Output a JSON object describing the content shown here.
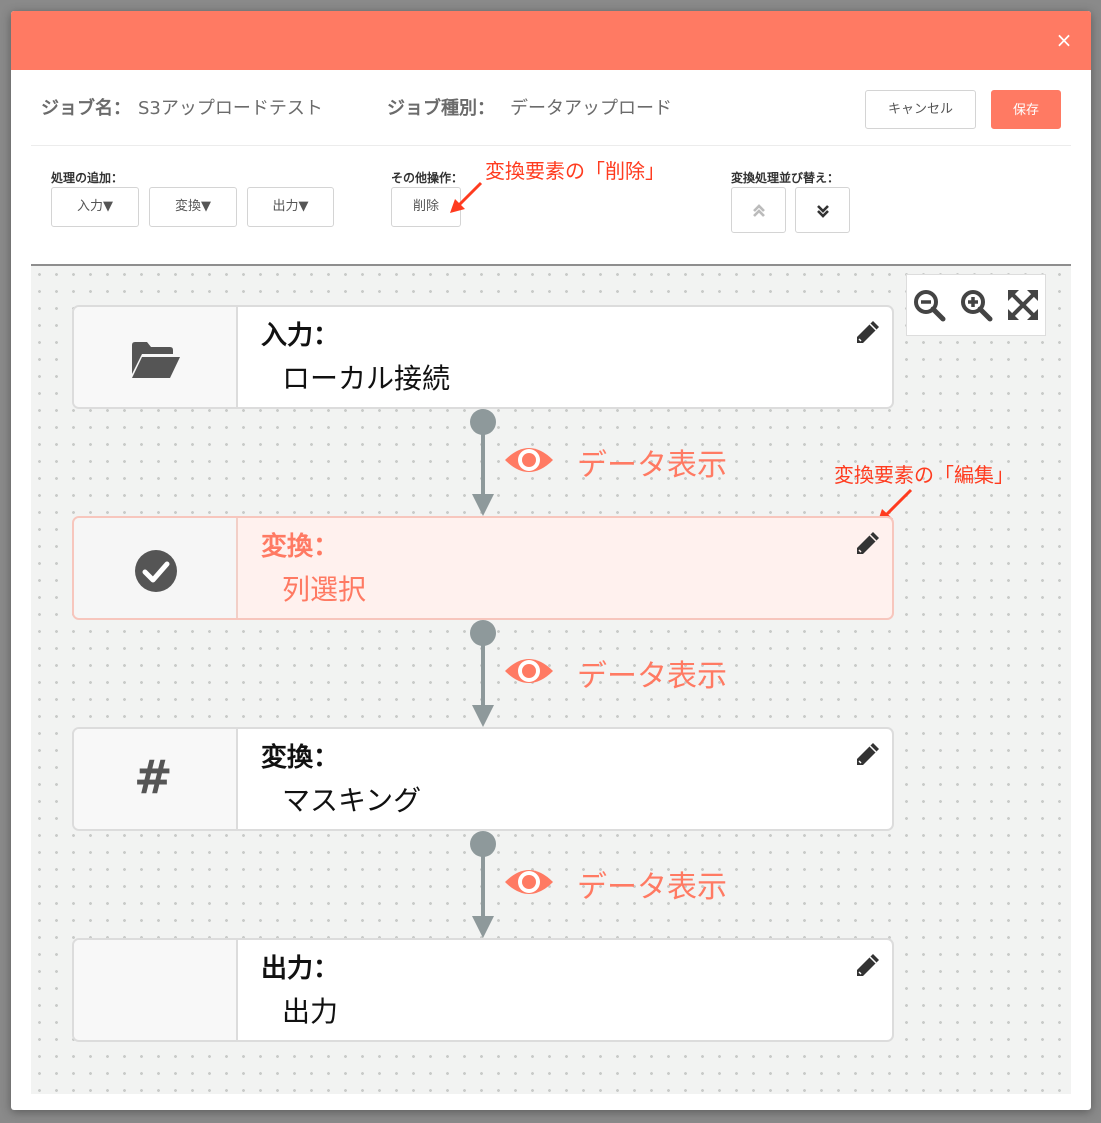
{
  "modal": {
    "close_glyph": "×"
  },
  "job": {
    "name_label": "ジョブ名：",
    "name_value": "S3アップロードテスト",
    "type_label": "ジョブ種別：",
    "type_value": "データアップロード"
  },
  "actions": {
    "cancel": "キャンセル",
    "save": "保存"
  },
  "toolbar": {
    "add_label": "処理の追加：",
    "add_buttons": [
      "入力▼",
      "変換▼",
      "出力▼"
    ],
    "other_label": "その他操作：",
    "delete": "削除",
    "sort_label": "変換処理並び替え：",
    "sort_up_glyph": "⌃",
    "sort_down_glyph": "⌄"
  },
  "annotations": {
    "delete_note": "変換要素の「削除」",
    "edit_note": "変換要素の「編集」",
    "color": "#ff3b1f"
  },
  "zoom": {
    "icons": [
      "zoom-out-icon",
      "zoom-in-icon",
      "fit-screen-icon"
    ]
  },
  "nodes": [
    {
      "title": "入力：",
      "subtitle": "ローカル接続",
      "icon": "folder-open-icon",
      "selected": false
    },
    {
      "title": "変換：",
      "subtitle": "列選択",
      "icon": "check-circle-icon",
      "selected": true
    },
    {
      "title": "変換：",
      "subtitle": "マスキング",
      "icon": "hash-icon",
      "icon_glyph": "#",
      "selected": false
    },
    {
      "title": "出力：",
      "subtitle": "出力",
      "icon": "",
      "selected": false
    }
  ],
  "connectors": [
    {
      "label": "データ表示",
      "icon": "eye-icon"
    },
    {
      "label": "データ表示",
      "icon": "eye-icon"
    },
    {
      "label": "データ表示",
      "icon": "eye-icon"
    }
  ],
  "colors": {
    "accent": "#ff7a63",
    "connector": "#8e999b"
  }
}
